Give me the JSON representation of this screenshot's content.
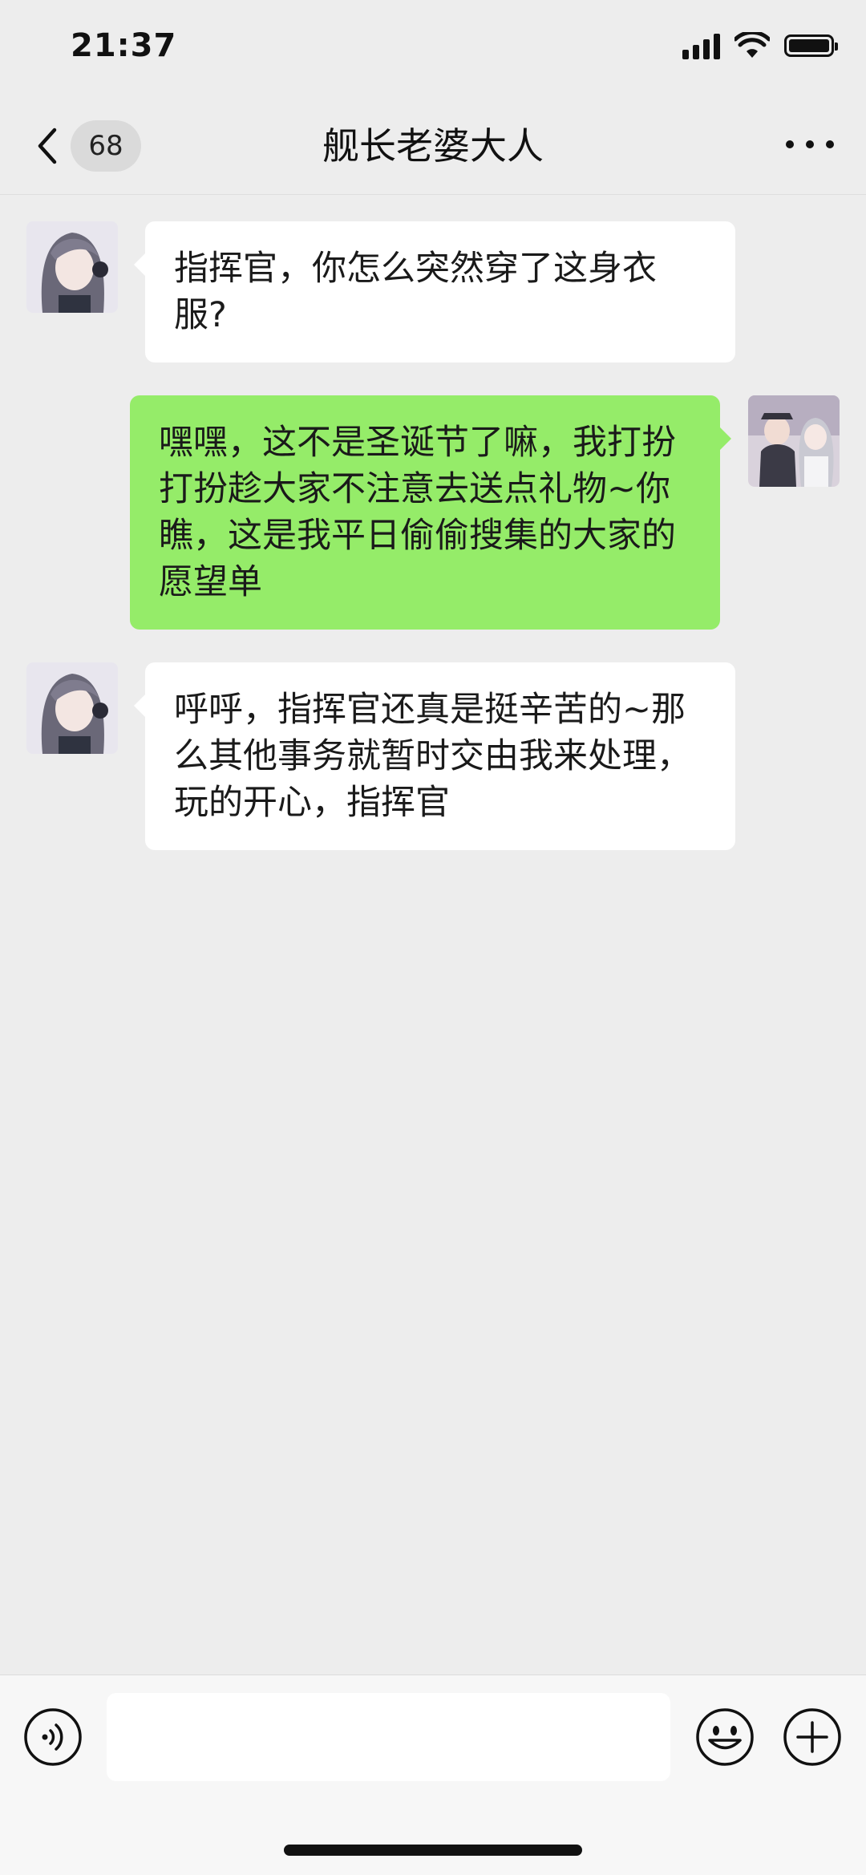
{
  "status_bar": {
    "time": "21:37",
    "icons": [
      "cellular-signal-icon",
      "wifi-icon",
      "battery-icon"
    ]
  },
  "nav": {
    "back_icon": "chevron-left-icon",
    "unread_count": "68",
    "title": "舰长老婆大人",
    "more_icon": "ellipsis-icon"
  },
  "messages": [
    {
      "direction": "incoming",
      "text": "指挥官，你怎么突然穿了这身衣服?"
    },
    {
      "direction": "outgoing",
      "text": "嘿嘿，这不是圣诞节了嘛，我打扮打扮趁大家不注意去送点礼物~你瞧，这是我平日偷偷搜集的大家的愿望单"
    },
    {
      "direction": "incoming",
      "text": "呼呼，指挥官还真是挺辛苦的~那么其他事务就暂时交由我来处理，玩的开心，指挥官"
    }
  ],
  "input_bar": {
    "voice_icon": "voice-input-icon",
    "input_value": "",
    "emoji_icon": "emoji-icon",
    "plus_icon": "plus-icon"
  },
  "colors": {
    "background": "#ededed",
    "incoming_bubble": "#ffffff",
    "outgoing_bubble": "#95ec69",
    "input_bar": "#f7f7f7"
  }
}
